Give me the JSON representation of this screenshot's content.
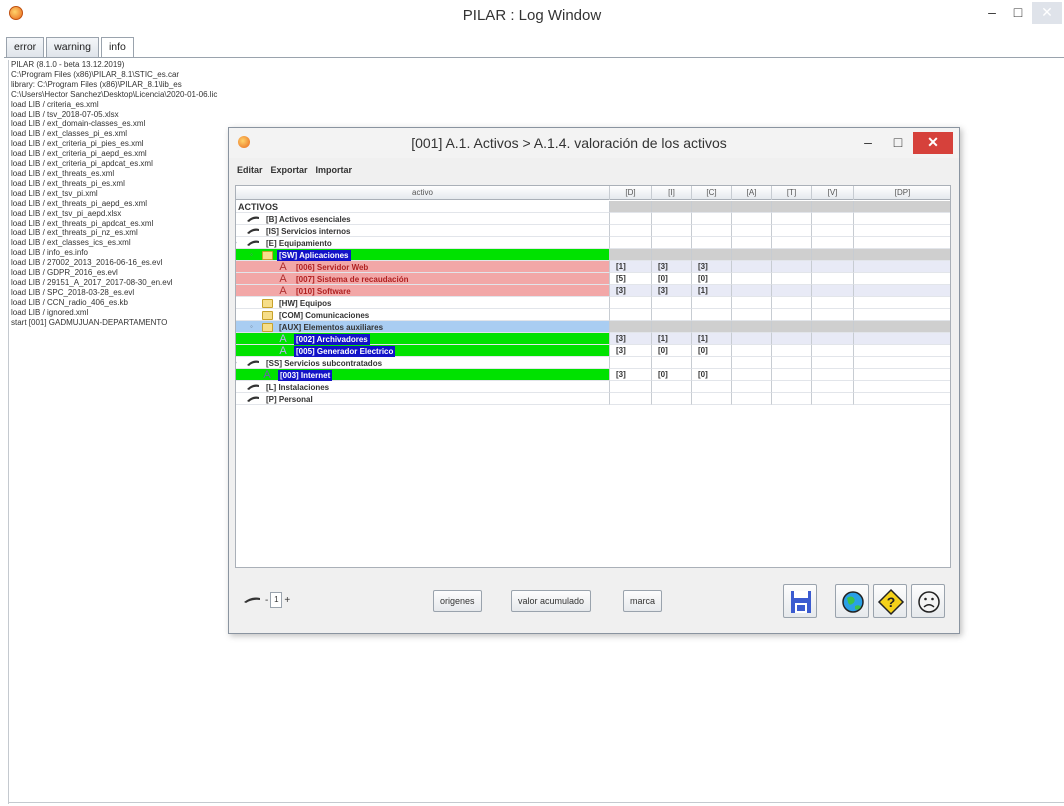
{
  "window": {
    "title": "PILAR : Log Window",
    "min_symbol": "–",
    "max_symbol": "□",
    "close_symbol": "✕"
  },
  "tabs": [
    {
      "label": "error"
    },
    {
      "label": "warning"
    },
    {
      "label": "info",
      "active": true
    }
  ],
  "log": [
    "PILAR (8.1.0 - beta 13.12.2019)",
    "C:\\Program Files (x86)\\PILAR_8.1\\STIC_es.car",
    "library: C:\\Program Files (x86)\\PILAR_8.1\\lib_es",
    "C:\\Users\\Hector Sanchez\\Desktop\\Licencia\\2020-01-06.lic",
    "load LIB / criteria_es.xml",
    "load LIB / tsv_2018-07-05.xlsx",
    "load LIB / ext_domain-classes_es.xml",
    "load LIB / ext_classes_pi_es.xml",
    "load LIB / ext_criteria_pi_pies_es.xml",
    "load LIB / ext_criteria_pi_aepd_es.xml",
    "load LIB / ext_criteria_pi_apdcat_es.xml",
    "load LIB / ext_threats_es.xml",
    "load LIB / ext_threats_pi_es.xml",
    "load LIB / ext_tsv_pi.xml",
    "load LIB / ext_threats_pi_aepd_es.xml",
    "load LIB / ext_tsv_pi_aepd.xlsx",
    "load LIB / ext_threats_pi_apdcat_es.xml",
    "load LIB / ext_threats_pi_nz_es.xml",
    "load LIB / ext_classes_ics_es.xml",
    "load LIB / info_es.info",
    "load LIB / 27002_2013_2016-06-16_es.evl",
    "load LIB / GDPR_2016_es.evl",
    "load LIB / 29151_A_2017_2017-08-30_en.evl",
    "load LIB / SPC_2018-03-28_es.evl",
    "load LIB / CCN_radio_406_es.kb",
    "load LIB / ignored.xml",
    "start [001] GADMUJUAN-DEPARTAMENTO"
  ],
  "dialog": {
    "title": "[001] A.1. Activos > A.1.4. valoración de los activos",
    "min_symbol": "–",
    "max_symbol": "□",
    "close_symbol": "✕",
    "menu": [
      "Editar",
      "Exportar",
      "Importar"
    ],
    "columns": [
      "activo",
      "[D]",
      "[I]",
      "[C]",
      "[A]",
      "[T]",
      "[V]",
      "[DP]"
    ],
    "root_label": "ACTIVOS",
    "rows": [
      {
        "label": "[B] Activos esenciales",
        "level": 1,
        "icon": "leaf",
        "bg": "white",
        "sel": false,
        "values": [
          "",
          "",
          "",
          "",
          "",
          "",
          ""
        ],
        "vbg": "gray"
      },
      {
        "label": "[IS] Servicios internos",
        "level": 1,
        "icon": "leaf",
        "bg": "white",
        "sel": false,
        "values": [
          "",
          "",
          "",
          "",
          "",
          "",
          ""
        ],
        "vbg": "gray"
      },
      {
        "label": "[E] Equipamiento",
        "level": 1,
        "icon": "leaf",
        "bg": "white",
        "sel": false,
        "expander": "open",
        "values": [
          "",
          "",
          "",
          "",
          "",
          "",
          ""
        ],
        "vbg": "gray"
      },
      {
        "label": "[SW] Aplicaciones",
        "level": 2,
        "icon": "folder",
        "bg": "green",
        "sel": true,
        "expander": "open",
        "values": [
          "",
          "",
          "",
          "",
          "",
          "",
          ""
        ],
        "vbg": "gray"
      },
      {
        "label": "[006] Servidor Web",
        "level": 3,
        "icon": "asset-red",
        "bg": "pink",
        "sel": false,
        "red": true,
        "values": [
          "[1]",
          "[3]",
          "[3]",
          "",
          "",
          "",
          ""
        ],
        "vbg": "lav"
      },
      {
        "label": "[007] Sistema de recaudación",
        "level": 3,
        "icon": "asset-red",
        "bg": "pink",
        "sel": false,
        "red": true,
        "values": [
          "[5]",
          "[0]",
          "[0]",
          "",
          "",
          "",
          ""
        ],
        "vbg": "white"
      },
      {
        "label": "[010] Software",
        "level": 3,
        "icon": "asset-red",
        "bg": "pink",
        "sel": false,
        "red": true,
        "values": [
          "[3]",
          "[3]",
          "[1]",
          "",
          "",
          "",
          ""
        ],
        "vbg": "lav"
      },
      {
        "label": "[HW] Equipos",
        "level": 2,
        "icon": "folder",
        "bg": "white",
        "sel": false,
        "values": [
          "",
          "",
          "",
          "",
          "",
          "",
          ""
        ],
        "vbg": "gray"
      },
      {
        "label": "[COM] Comunicaciones",
        "level": 2,
        "icon": "folder",
        "bg": "white",
        "sel": false,
        "values": [
          "",
          "",
          "",
          "",
          "",
          "",
          ""
        ],
        "vbg": "gray"
      },
      {
        "label": "[AUX] Elementos auxiliares",
        "level": 2,
        "icon": "folder",
        "bg": "blue",
        "sel": false,
        "expander": "open",
        "values": [
          "",
          "",
          "",
          "",
          "",
          "",
          ""
        ],
        "vbg": "gray"
      },
      {
        "label": "[002] Archivadores",
        "level": 3,
        "icon": "asset-pale",
        "bg": "green",
        "sel": true,
        "values": [
          "[3]",
          "[1]",
          "[1]",
          "",
          "",
          "",
          ""
        ],
        "vbg": "lav"
      },
      {
        "label": "[005] Generador Electrico",
        "level": 3,
        "icon": "asset-pale",
        "bg": "green",
        "sel": true,
        "values": [
          "[3]",
          "[0]",
          "[0]",
          "",
          "",
          "",
          ""
        ],
        "vbg": "white"
      },
      {
        "label": "[SS] Servicios subcontratados",
        "level": 1,
        "icon": "leaf",
        "bg": "white",
        "sel": false,
        "expander": "open",
        "values": [
          "",
          "",
          "",
          "",
          "",
          "",
          ""
        ],
        "vbg": "gray"
      },
      {
        "label": "[003] Internet",
        "level": 2,
        "icon": "asset-green",
        "bg": "green",
        "sel": true,
        "values": [
          "[3]",
          "[0]",
          "[0]",
          "",
          "",
          "",
          ""
        ],
        "vbg": "white"
      },
      {
        "label": "[L] Instalaciones",
        "level": 1,
        "icon": "leaf",
        "bg": "white",
        "sel": false,
        "values": [
          "",
          "",
          "",
          "",
          "",
          "",
          ""
        ],
        "vbg": "gray"
      },
      {
        "label": "[P] Personal",
        "level": 1,
        "icon": "leaf",
        "bg": "white",
        "sel": false,
        "values": [
          "",
          "",
          "",
          "",
          "",
          "",
          ""
        ],
        "vbg": "gray"
      }
    ],
    "bottom": {
      "stepper_minus": "-",
      "stepper_value": "1",
      "stepper_plus": "+",
      "buttons": [
        "origenes",
        "valor acumulado",
        "marca"
      ],
      "icons": [
        "save-icon",
        "globe-icon",
        "help-icon",
        "sad-face-icon"
      ]
    }
  }
}
